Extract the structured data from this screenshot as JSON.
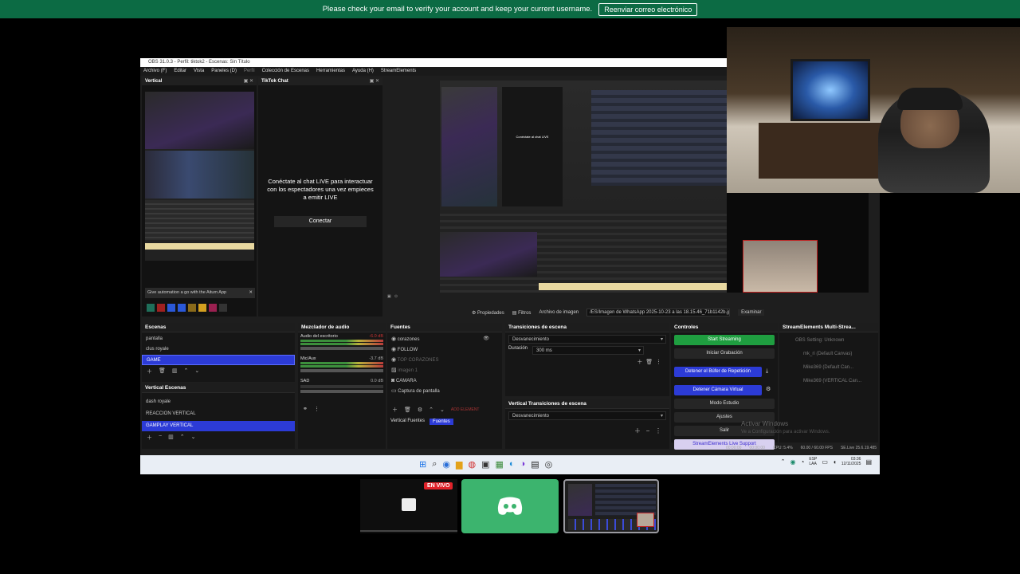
{
  "banner": {
    "message": "Please check your email to verify your account and keep your current username.",
    "button": "Reenviar correo electrónico"
  },
  "obs": {
    "title": "OBS 31.0.3 - Perfil: tiktok2 - Escenas: Sin Título",
    "menu": [
      "Archivo (F)",
      "Editar",
      "Vista",
      "Paneles (D)",
      "Perfil",
      "Colección de Escenas",
      "Herramientas",
      "Ayuda (H)",
      "StreamElements"
    ],
    "vertical_dock": {
      "title": "Vertical",
      "promo": "Give automation a go with the Aitum App"
    },
    "tiktok_dock": {
      "title": "TikTok Chat",
      "message": "Conéctate al chat LIVE para interactuar con los espectadores una vez empieces a emitir LIVE",
      "button": "Conectar"
    },
    "source_toolbar": {
      "properties": "Propiedades",
      "filters": "Filtros",
      "image_label": "Archivo de imagen",
      "path": "/ES/Imagen de WhatsApp 2025-10-23 a las 18.15.46_71b1142b.jpg",
      "browse": "Examinar"
    },
    "scenes": {
      "title": "Escenas",
      "items": [
        "pantalla",
        "clus royale",
        "GAME"
      ]
    },
    "vertical_scenes": {
      "title": "Vertical Escenas",
      "items": [
        "dash royale",
        "REACCION VERTICAL",
        "GAMPLAY VERTICAL"
      ]
    },
    "mixer": {
      "title": "Mezclador de audio",
      "channels": [
        {
          "name": "Audio del escritorio",
          "db": "-6.0 dB"
        },
        {
          "name": "Mic/Aux",
          "db": "-3.7 dB"
        },
        {
          "name": "SAD",
          "db": "0.0 dB"
        }
      ]
    },
    "sources": {
      "title": "Fuentes",
      "items": [
        "corazones",
        "FOLLOW",
        "TOP CORAZONES",
        "imagen 1",
        "CAMARA",
        "Captura de pantalla"
      ],
      "add_element": "ADD ELEMENT",
      "tabs": [
        "Vertical Fuentes",
        "Fuentes"
      ]
    },
    "transitions": {
      "title": "Transiciones de escena",
      "value": "Desvanecimiento",
      "duration_label": "Duración",
      "duration": "300 ms"
    },
    "vertical_transitions": {
      "title": "Vertical Transiciones de escena",
      "value": "Desvanecimiento"
    },
    "controls": {
      "title": "Controles",
      "buttons": [
        "Start Streaming",
        "Iniciar Grabación",
        "Detener el Búfer de Repetición",
        "Detener Cámara Virtual",
        "Modo Estudio",
        "Ajustes",
        "Salir",
        "StreamElements Live Support"
      ]
    },
    "multistream": {
      "title": "StreamElements Multi-Strea...",
      "items": [
        "OBS Setting: Unknown",
        "mk_ri (Default Canvas)",
        "Mike369 (Default Can...",
        "Mike369 (VERTICAL Can..."
      ]
    },
    "watermark": {
      "line1": "Activar Windows",
      "line2": "Ve a Configuración para activar Windows."
    },
    "statusbar": {
      "time1": "00:00:00",
      "time2": "00:00:00",
      "cpu": "CPU: 5.4%",
      "fps": "60.00 / 60.00 FPS",
      "kbps": "SE.Live 25.6.19.485"
    },
    "tray": {
      "lang1": "ESP",
      "lang2": "LAA",
      "time": "03:36",
      "date": "12/11/2025"
    }
  },
  "taskbar_popup": {
    "badge": "EN VIVO"
  },
  "colors": {
    "banner": "#0c6b44",
    "start_streaming": "#1f9e40",
    "selected": "#2c3bd6",
    "discord": "#3cb46e"
  }
}
